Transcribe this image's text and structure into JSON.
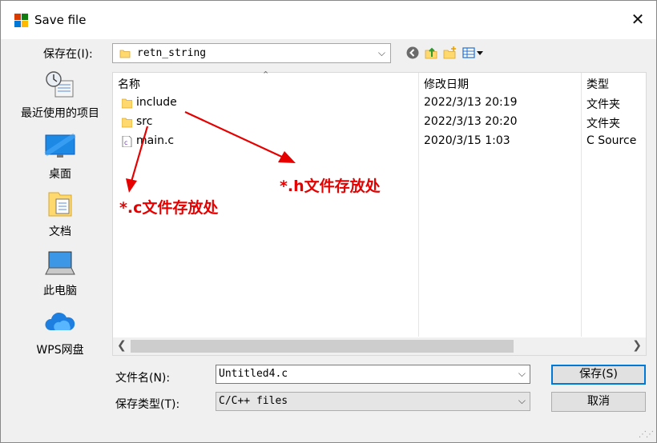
{
  "window": {
    "title": "Save file"
  },
  "toolbar": {
    "look_in_label": "保存在(I):",
    "look_in_value": "retn_string",
    "icons": [
      "back-icon",
      "up-folder-icon",
      "new-folder-icon",
      "view-menu-icon"
    ]
  },
  "places": [
    {
      "label": "最近使用的项目",
      "icon": "recent-icon"
    },
    {
      "label": "桌面",
      "icon": "desktop-icon"
    },
    {
      "label": "文档",
      "icon": "documents-icon"
    },
    {
      "label": "此电脑",
      "icon": "computer-icon"
    },
    {
      "label": "WPS网盘",
      "icon": "cloud-icon"
    }
  ],
  "columns": {
    "name": "名称",
    "modified": "修改日期",
    "type": "类型"
  },
  "files": [
    {
      "name": "include",
      "modified": "2022/3/13 20:19",
      "type": "文件夹",
      "icon": "folder-icon"
    },
    {
      "name": "src",
      "modified": "2022/3/13 20:20",
      "type": "文件夹",
      "icon": "folder-icon"
    },
    {
      "name": "main.c",
      "modified": "2020/3/15 1:03",
      "type": "C Source",
      "icon": "c-file-icon"
    }
  ],
  "form": {
    "filename_label": "文件名(N):",
    "filename_value": "Untitled4.c",
    "filetype_label": "保存类型(T):",
    "filetype_value": "C/C++ files"
  },
  "buttons": {
    "save": "保存(S)",
    "cancel": "取消"
  },
  "annotations": {
    "h_note": "*.h文件存放处",
    "c_note": "*.c文件存放处",
    "color": "#e60000"
  }
}
